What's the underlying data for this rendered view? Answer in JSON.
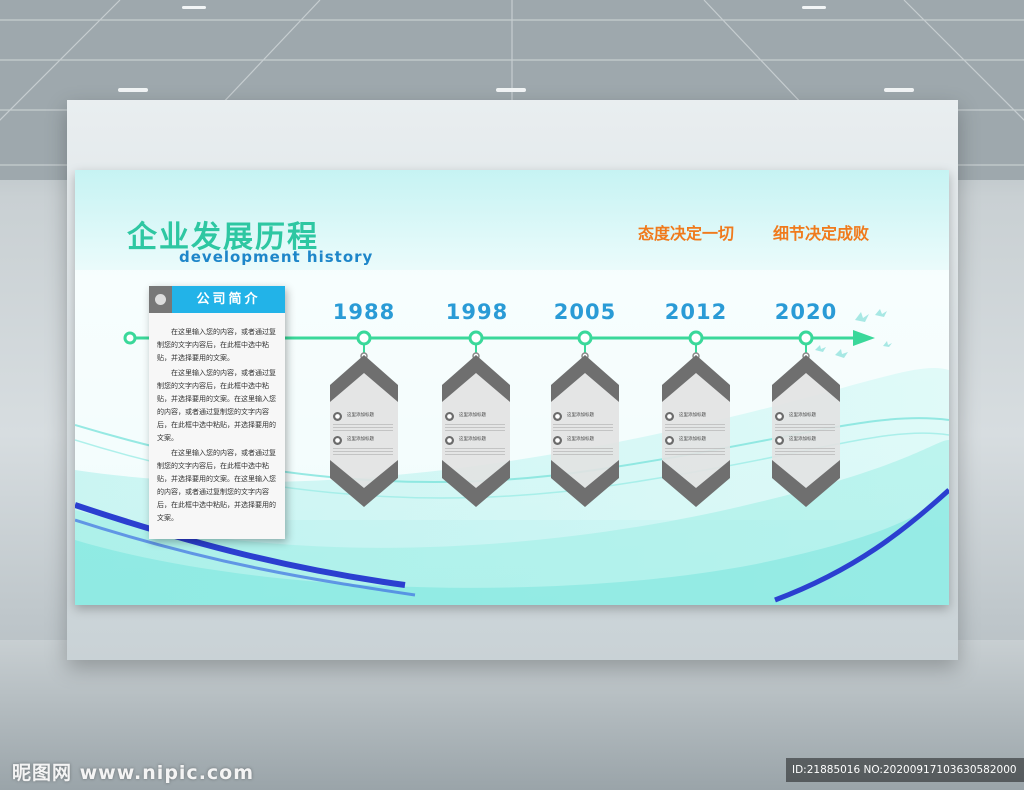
{
  "board": {
    "title_cn": "企业发展历程",
    "title_en": "development history",
    "slogan_1": "态度决定一切",
    "slogan_2": "细节决定成败"
  },
  "intro": {
    "label": "公司简介",
    "paragraphs": [
      "在这里输入您的内容，或者通过复制您的文字内容后，在此框中选中粘贴，并选择要用的文案。",
      "在这里输入您的内容，或者通过复制您的文字内容后，在此框中选中粘贴，并选择要用的文案。在这里输入您的内容，或者通过复制您的文字内容后，在此框中选中粘贴，并选择要用的文案。",
      "在这里输入您的内容，或者通过复制您的文字内容后，在此框中选中粘贴，并选择要用的文案。在这里输入您的内容，或者通过复制您的文字内容后，在此框中选中粘贴，并选择要用的文案。"
    ]
  },
  "timeline": [
    {
      "year": "1988",
      "items": [
        "这里添加标题",
        "这里添加标题"
      ]
    },
    {
      "year": "1998",
      "items": [
        "这里添加标题",
        "这里添加标题"
      ]
    },
    {
      "year": "2005",
      "items": [
        "这里添加标题",
        "这里添加标题"
      ]
    },
    {
      "year": "2012",
      "items": [
        "这里添加标题",
        "这里添加标题"
      ]
    },
    {
      "year": "2020",
      "items": [
        "这里添加标题",
        "这里添加标题"
      ]
    }
  ],
  "colors": {
    "title_green": "#2ec7a2",
    "subtitle_blue": "#1e86c9",
    "slogan_orange": "#f07a1c",
    "timeline_green": "#3ad89a",
    "year_blue": "#2a9bd6",
    "tab_blue": "#22b3e8"
  },
  "footer": {
    "watermark": "昵图网 www.nipic.com",
    "image_id": "ID:21885016 NO:20200917103630582000"
  }
}
